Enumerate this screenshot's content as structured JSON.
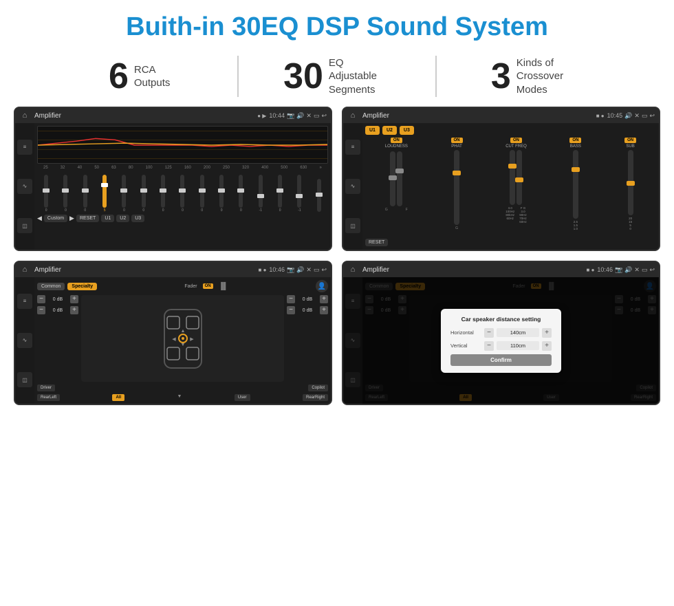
{
  "title": "Buith-in 30EQ DSP Sound System",
  "stats": [
    {
      "number": "6",
      "label": "RCA\nOutputs"
    },
    {
      "number": "30",
      "label": "EQ Adjustable\nSegments"
    },
    {
      "number": "3",
      "label": "Kinds of\nCrossover Modes"
    }
  ],
  "screens": [
    {
      "id": "eq-screen",
      "topbar": {
        "app": "Amplifier",
        "time": "10:44"
      },
      "type": "eq"
    },
    {
      "id": "crossover-screen",
      "topbar": {
        "app": "Amplifier",
        "time": "10:45"
      },
      "type": "crossover"
    },
    {
      "id": "fader-screen",
      "topbar": {
        "app": "Amplifier",
        "time": "10:46"
      },
      "type": "fader"
    },
    {
      "id": "dialog-screen",
      "topbar": {
        "app": "Amplifier",
        "time": "10:46"
      },
      "type": "fader-dialog"
    }
  ],
  "eq": {
    "frequencies": [
      "25",
      "32",
      "40",
      "50",
      "63",
      "80",
      "100",
      "125",
      "160",
      "200",
      "250",
      "320",
      "400",
      "500",
      "630"
    ],
    "values": [
      "0",
      "0",
      "0",
      "5",
      "0",
      "0",
      "0",
      "0",
      "0",
      "0",
      "0",
      "-1",
      "0",
      "-1",
      ""
    ],
    "thumbPositions": [
      50,
      50,
      50,
      35,
      50,
      50,
      50,
      50,
      50,
      50,
      50,
      60,
      50,
      60,
      50
    ],
    "presets": [
      "Custom",
      "RESET",
      "U1",
      "U2",
      "U3"
    ],
    "mode_label": "Custom"
  },
  "crossover": {
    "presets": [
      "U1",
      "U2",
      "U3"
    ],
    "columns": [
      "LOUDNESS",
      "PHAT",
      "CUT FREQ",
      "BASS",
      "SUB"
    ],
    "reset_label": "RESET"
  },
  "fader": {
    "common_label": "Common",
    "specialty_label": "Specialty",
    "fader_label": "Fader",
    "on_label": "ON",
    "controls": [
      "0 dB",
      "0 dB",
      "0 dB",
      "0 dB"
    ],
    "buttons": [
      "Driver",
      "RearLeft",
      "All",
      "User",
      "RearRight",
      "Copilot"
    ]
  },
  "dialog": {
    "title": "Car speaker distance setting",
    "horizontal_label": "Horizontal",
    "horizontal_value": "140cm",
    "vertical_label": "Vertical",
    "vertical_value": "110cm",
    "confirm_label": "Confirm"
  }
}
